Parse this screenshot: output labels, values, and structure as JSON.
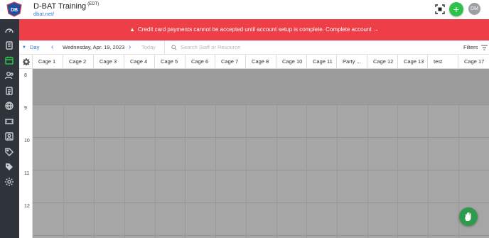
{
  "header": {
    "title": "D-BAT Training",
    "timezone": "(EDT)",
    "link": "dbat.net/",
    "avatar_initials": "DM",
    "add_label": "+"
  },
  "banner": {
    "message": "Credit card payments cannot be accepted until account setup is complete. Complete account →",
    "color": "#ee3e48"
  },
  "toolbar": {
    "view_label": "Day",
    "date": "Wednesday, Apr. 19, 2023",
    "today_label": "Today",
    "search_placeholder": "Search Staff or Resource",
    "filters_label": "Filters"
  },
  "columns": [
    "Cage 1",
    "Cage 2",
    "Cage 3",
    "Cage 4",
    "Cage 5",
    "Cage 6",
    "Cage 7",
    "Cage 8",
    "Cage 10",
    "Cage 11",
    "Party ...",
    "Cage 12",
    "Cage 13",
    "test",
    "Cage 17"
  ],
  "hours": [
    "8",
    "9",
    "10",
    "11",
    "12"
  ],
  "sidebar_icons": [
    "dashboard-icon",
    "book-icon",
    "calendar-icon",
    "users-icon",
    "list-icon",
    "globe-icon",
    "ticket-icon",
    "contact-card-icon",
    "tag-icon",
    "tags-icon",
    "settings-icon"
  ],
  "colors": {
    "accent_green": "#2ec24b",
    "link_blue": "#2b7bd6",
    "sidebar": "#2f343a"
  }
}
